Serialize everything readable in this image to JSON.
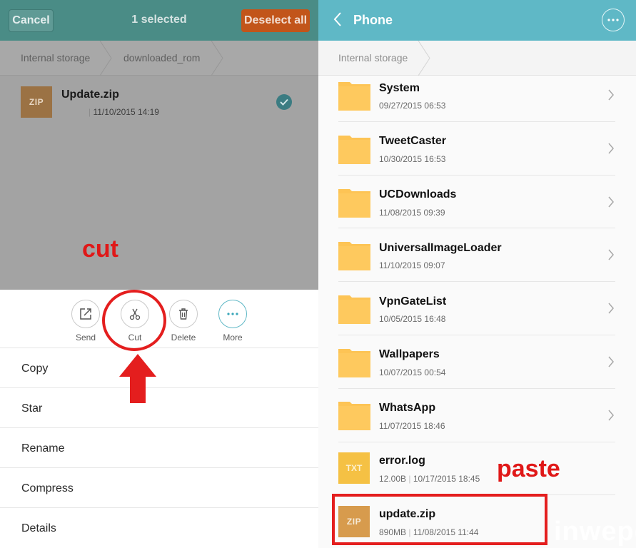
{
  "left": {
    "header": {
      "cancel": "Cancel",
      "title": "1 selected",
      "deselect_all": "Deselect all"
    },
    "breadcrumb": [
      "Internal storage",
      "downloaded_rom"
    ],
    "file": {
      "icon_label": "ZIP",
      "name": "Update.zip",
      "date": "11/10/2015 14:19"
    },
    "annotation": "cut",
    "actions": [
      {
        "icon": "share-icon",
        "label": "Send"
      },
      {
        "icon": "scissors-icon",
        "label": "Cut"
      },
      {
        "icon": "trash-icon",
        "label": "Delete"
      },
      {
        "icon": "more-icon",
        "label": "More"
      }
    ],
    "menu": [
      "Copy",
      "Star",
      "Rename",
      "Compress",
      "Details"
    ]
  },
  "right": {
    "header": {
      "title": "Phone"
    },
    "breadcrumb": [
      "Internal storage"
    ],
    "folders": [
      {
        "name": "System",
        "date": "09/27/2015 06:53"
      },
      {
        "name": "TweetCaster",
        "date": "10/30/2015 16:53"
      },
      {
        "name": "UCDownloads",
        "date": "11/08/2015 09:39"
      },
      {
        "name": "UniversalImageLoader",
        "date": "11/10/2015 09:07"
      },
      {
        "name": "VpnGateList",
        "date": "10/05/2015 16:48"
      },
      {
        "name": "Wallpapers",
        "date": "10/07/2015 00:54"
      },
      {
        "name": "WhatsApp",
        "date": "11/07/2015 18:46"
      }
    ],
    "files": [
      {
        "icon_label": "TXT",
        "name": "error.log",
        "size": "12.00B",
        "date": "10/17/2015 18:45"
      },
      {
        "icon_label": "ZIP",
        "name": "update.zip",
        "size": "890MB",
        "date": "11/08/2015 11:44"
      }
    ],
    "annotation": "paste",
    "watermark": "inwepo"
  },
  "colors": {
    "left_header": "#4a8c86",
    "deselect_button": "#c2551a",
    "right_header": "#5fb8c6",
    "folder": "#fdc455",
    "annotation_red": "#e41e1e"
  }
}
